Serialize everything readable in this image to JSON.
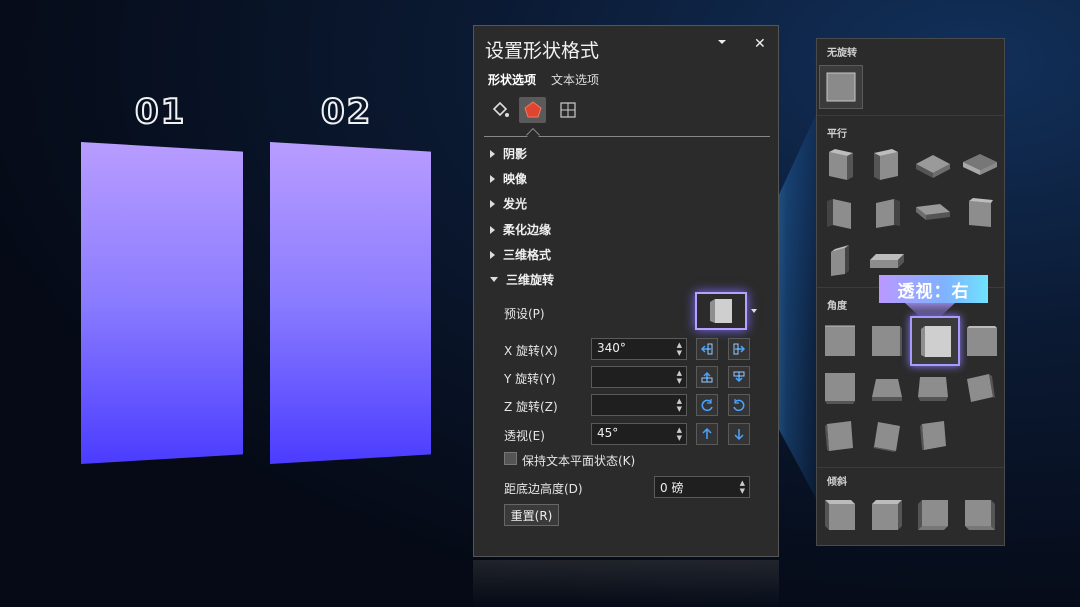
{
  "slides": {
    "num1": "01",
    "num2": "02"
  },
  "pane": {
    "title": "设置形状格式",
    "dropdown_icon": "chevron-down-icon",
    "close_icon": "close-icon",
    "close_label": "✕",
    "tabs": {
      "shape": "形状选项",
      "text": "文本选项"
    },
    "sections": {
      "shadow": "阴影",
      "reflection": "映像",
      "glow": "发光",
      "soft_edges": "柔化边缘",
      "format_3d": "三维格式",
      "rotation_3d": "三维旋转"
    },
    "rotation": {
      "preset_label": "预设(P)",
      "x_label": "X 旋转(X)",
      "x_value": "340°",
      "y_label": "Y 旋转(Y)",
      "y_value": "",
      "z_label": "Z 旋转(Z)",
      "z_value": "",
      "perspective_label": "透视(E)",
      "perspective_value": "45°",
      "keep_flat_label": "保持文本平面状态(K)",
      "distance_label": "距底边高度(D)",
      "distance_value": "0 磅",
      "reset_label": "重置(R)"
    }
  },
  "gallery": {
    "no_rotation": "无旋转",
    "parallel": "平行",
    "perspective": "角度",
    "oblique": "倾斜",
    "tooltip": "透视：右"
  },
  "colors": {
    "accent_purple": "#b8a0ff",
    "accent_blue": "#4b3cff",
    "pane_bg": "#2b2b2b",
    "tooltip_cyan": "#6fe3ff"
  }
}
